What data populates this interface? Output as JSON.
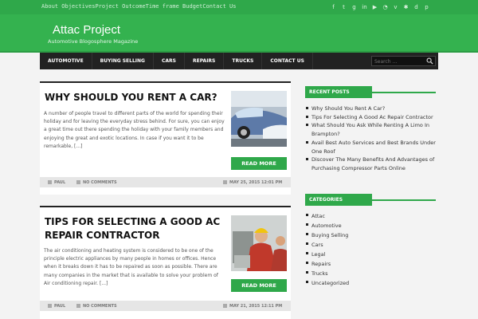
{
  "topbar": {
    "menu": [
      "About Objectives",
      "Project Outcome",
      "Time frame",
      "Budget",
      "Contact Us"
    ],
    "social_icons": [
      "facebook-icon",
      "twitter-icon",
      "google-plus-icon",
      "linkedin-icon",
      "youtube-icon",
      "rss-icon",
      "vimeo-icon",
      "yelp-icon",
      "digg-icon",
      "pinterest-icon"
    ]
  },
  "header": {
    "title": "Attac Project",
    "tagline": "Automotive Blogosphere Magazine"
  },
  "nav": {
    "items": [
      "Automotive",
      "Buying Selling",
      "Cars",
      "Repairs",
      "Trucks",
      "Contact Us"
    ]
  },
  "search": {
    "placeholder": "Search ..."
  },
  "posts": [
    {
      "title": "Why Should You Rent A Car?",
      "excerpt": "A number of people travel to different parts of the world for spending their holiday and for leaving the everyday stress behind. For sure, you can enjoy a great time out there spending the holiday with your family members and enjoying the great and exotic locations. In case if you want it to be remarkable, [...]",
      "read_more": "Read More",
      "author": "Paul",
      "comments": "No Comments",
      "date": "May 25, 2015 12:01 PM"
    },
    {
      "title": "Tips For Selecting A Good AC Repair Contractor",
      "excerpt": "The air conditioning and heating system is considered to be one of the principle electric appliances by many people in homes or offices. Hence when it breaks down it has to be repaired as soon as possible. There are many companies in the market that is available to solve your problem of Air conditioning repair. [...]",
      "read_more": "Read More",
      "author": "Paul",
      "comments": "No Comments",
      "date": "May 21, 2015 12:11 PM"
    }
  ],
  "sidebar": {
    "recent_title": "Recent Posts",
    "recent": [
      "Why Should You Rent A Car?",
      "Tips For Selecting A Good Ac Repair Contractor",
      "What Should You Ask While Renting A Limo In Brampton?",
      "Avail Best Auto Services and Best Brands Under One Roof",
      "Discover The Many Benefits And Advantages of Purchasing Compressor Parts Online"
    ],
    "categories_title": "Categories",
    "categories": [
      "Attac",
      "Automotive",
      "Buying Selling",
      "Cars",
      "Legal",
      "Repairs",
      "Trucks",
      "Uncategorized"
    ]
  }
}
